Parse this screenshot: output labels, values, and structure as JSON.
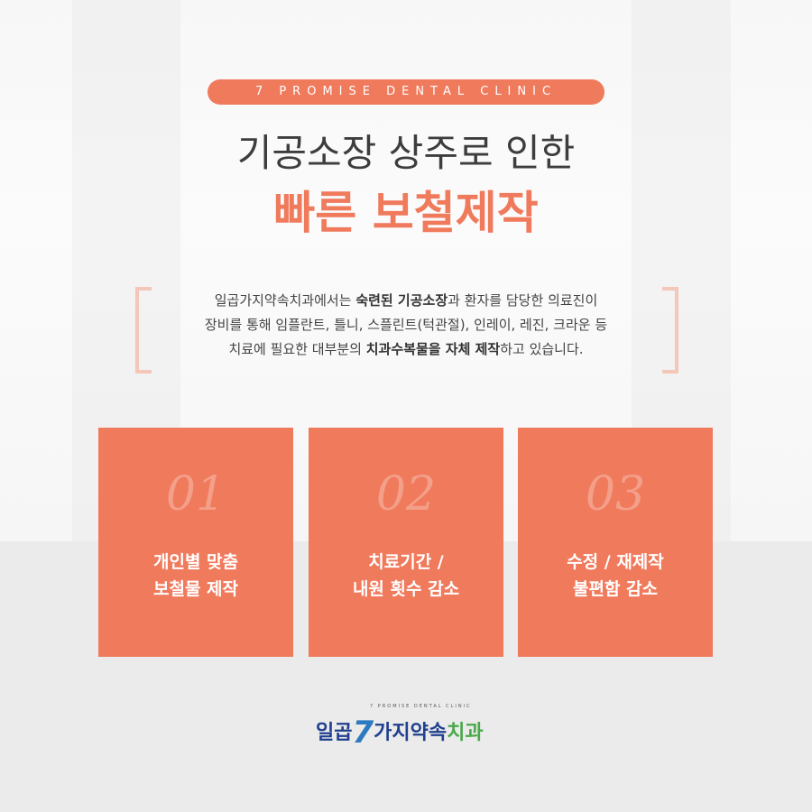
{
  "header": {
    "tag": "7 PROMISE DENTAL CLINIC",
    "title_line1": "기공소장 상주로 인한",
    "title_line2": "빠른 보철제작"
  },
  "description": {
    "line1_a": "일곱가지약속치과에서는 ",
    "line1_b": "숙련된 기공소장",
    "line1_c": "과 환자를 담당한 의료진이",
    "line2": "장비를 통해 임플란트, 틀니, 스플린트(턱관절), 인레이, 레진, 크라운 등",
    "line3_a": "치료에 필요한 대부분의 ",
    "line3_b": "치과수복물을 자체 제작",
    "line3_c": "하고 있습니다."
  },
  "cards": [
    {
      "num": "01",
      "line1": "개인별 맞춤",
      "line2": "보철물 제작"
    },
    {
      "num": "02",
      "line1": "치료기간 /",
      "line2": "내원 횟수 감소"
    },
    {
      "num": "03",
      "line1": "수정 / 재제작",
      "line2": "불편함 감소"
    }
  ],
  "logo": {
    "sub": "7 PROMISE DENTAL CLINIC",
    "part1": "일곱",
    "seven": "7",
    "part2": "가지약속",
    "part3": "치과"
  },
  "colors": {
    "accent": "#f07a5c",
    "logo_blue": "#1f3f8f",
    "logo_green": "#4aa84a"
  }
}
